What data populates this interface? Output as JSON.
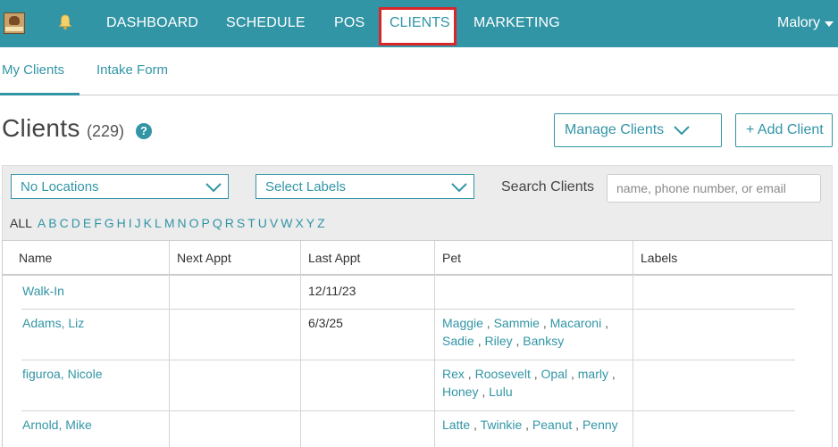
{
  "nav": {
    "items": [
      {
        "label": "DASHBOARD"
      },
      {
        "label": "SCHEDULE"
      },
      {
        "label": "POS"
      },
      {
        "label": "CLIENTS"
      },
      {
        "label": "MARKETING"
      }
    ],
    "user": "Malory"
  },
  "subtabs": [
    {
      "label": "My Clients"
    },
    {
      "label": "Intake Form"
    }
  ],
  "page": {
    "title": "Clients",
    "count": "(229)",
    "help": "?"
  },
  "buttons": {
    "manage": "Manage Clients",
    "add": "+ Add Client"
  },
  "filters": {
    "locations": "No Locations",
    "labels": "Select Labels",
    "search_label": "Search Clients",
    "search_placeholder": "name, phone number, or email",
    "search_value": ""
  },
  "alphabet": {
    "all": "ALL",
    "letters": [
      "A",
      "B",
      "C",
      "D",
      "E",
      "F",
      "G",
      "H",
      "I",
      "J",
      "K",
      "L",
      "M",
      "N",
      "O",
      "P",
      "Q",
      "R",
      "S",
      "T",
      "U",
      "V",
      "W",
      "X",
      "Y",
      "Z"
    ]
  },
  "table": {
    "headers": [
      "Name",
      "Next Appt",
      "Last Appt",
      "Pet",
      "Labels"
    ],
    "rows": [
      {
        "name": "Walk-In",
        "next_appt": "",
        "last_appt": "12/11/23",
        "pet_lines": [],
        "labels": ""
      },
      {
        "name": "Adams, Liz",
        "next_appt": "",
        "last_appt": "6/3/25",
        "pet_lines": [
          [
            "Maggie",
            "Sammie",
            "Macaroni"
          ],
          [
            "Sadie",
            "Riley",
            "Banksy"
          ]
        ],
        "labels": ""
      },
      {
        "name": "figuroa, Nicole",
        "next_appt": "",
        "last_appt": "",
        "pet_lines": [
          [
            "Rex",
            "Roosevelt",
            "Opal",
            "marly"
          ],
          [
            "Honey",
            "Lulu"
          ]
        ],
        "labels": ""
      },
      {
        "name": "Arnold, Mike",
        "next_appt": "",
        "last_appt": "",
        "pet_lines": [
          [
            "Latte",
            "Twinkie",
            "Peanut",
            "Penny"
          ]
        ],
        "labels": ""
      }
    ]
  },
  "colors": {
    "accent": "#3295a6",
    "highlight_border": "#d9262a"
  },
  "icons": [
    "logo",
    "bell-icon",
    "caret-down-icon",
    "help-icon",
    "chevron-down-icon"
  ]
}
